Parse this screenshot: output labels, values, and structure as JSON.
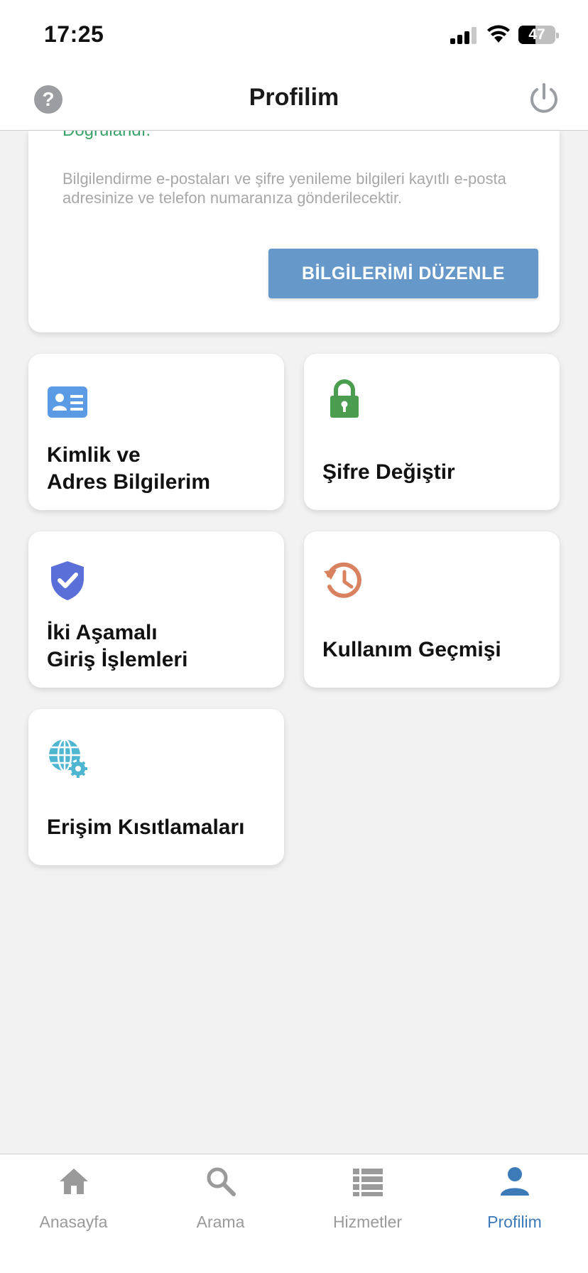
{
  "status_bar": {
    "time": "17:25",
    "battery_percent": "47",
    "battery_level": 0.47
  },
  "header": {
    "title": "Profilim",
    "help_icon": "question-circle-icon",
    "power_icon": "power-icon"
  },
  "profile_card": {
    "verified_text": "Doğrulandı.",
    "info_text": "Bilgilendirme e-postaları ve şifre yenileme bilgileri kayıtlı e-posta adresinize ve telefon numaranıza gönderilecektir.",
    "edit_button_label": "BİLGİLERİMİ DÜZENLE"
  },
  "tiles": [
    {
      "label": "Kimlik ve\nAdres Bilgilerim",
      "icon": "id-card-icon",
      "color": "#5b9be6"
    },
    {
      "label": "Şifre Değiştir",
      "icon": "lock-icon",
      "color": "#4a9d4e"
    },
    {
      "label": "İki Aşamalı\nGiriş İşlemleri",
      "icon": "shield-check-icon",
      "color": "#5a6fd8"
    },
    {
      "label": "Kullanım Geçmişi",
      "icon": "history-icon",
      "color": "#d9825f"
    },
    {
      "label": "Erişim Kısıtlamaları",
      "icon": "globe-gear-icon",
      "color": "#4fb6d2"
    }
  ],
  "tab_bar": {
    "tabs": [
      {
        "label": "Anasayfa",
        "icon": "home-icon"
      },
      {
        "label": "Arama",
        "icon": "search-icon"
      },
      {
        "label": "Hizmetler",
        "icon": "list-icon"
      },
      {
        "label": "Profilim",
        "icon": "person-icon"
      }
    ],
    "active_tab": "Profilim",
    "active_color": "#3d7ab8",
    "inactive_color": "#9a9a9a"
  }
}
